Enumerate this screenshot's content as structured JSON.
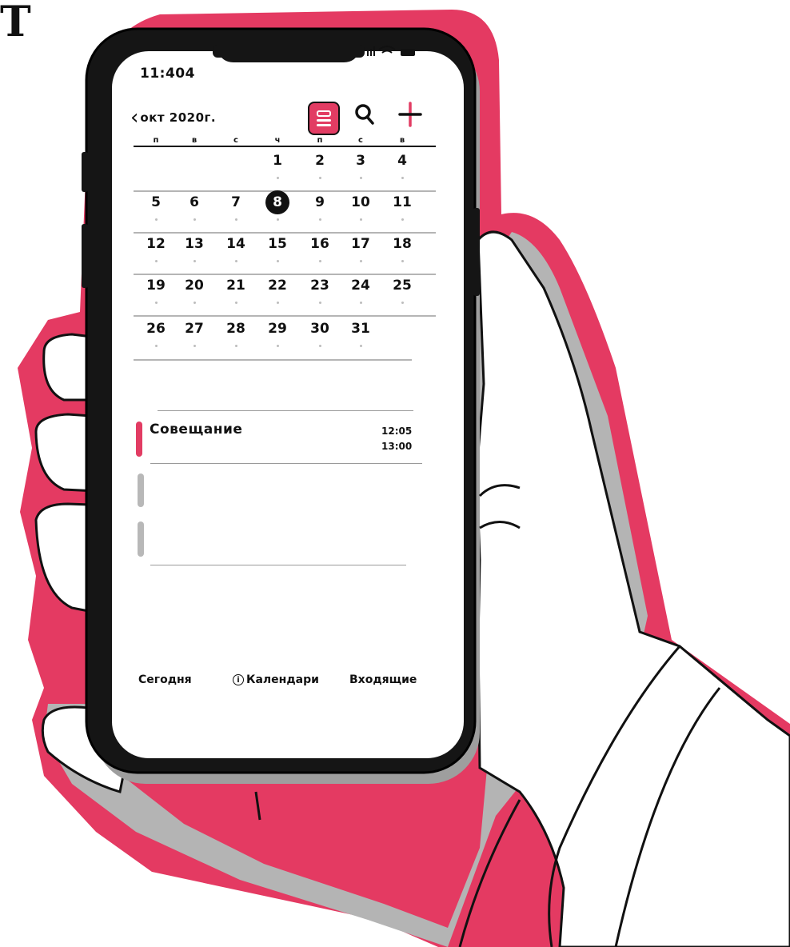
{
  "corner_mark": "Т",
  "status_bar": {
    "time": "11:404"
  },
  "header": {
    "month_label": "окт 2020г."
  },
  "calendar": {
    "weekdays": [
      "п",
      "в",
      "с",
      "ч",
      "п",
      "с",
      "в"
    ],
    "today": "8",
    "weeks": [
      [
        "",
        "",
        "",
        "1",
        "2",
        "3",
        "4"
      ],
      [
        "5",
        "6",
        "7",
        "8",
        "9",
        "10",
        "11"
      ],
      [
        "12",
        "13",
        "14",
        "15",
        "16",
        "17",
        "18"
      ],
      [
        "19",
        "20",
        "21",
        "22",
        "23",
        "24",
        "25"
      ],
      [
        "26",
        "27",
        "28",
        "29",
        "30",
        "31",
        ""
      ]
    ]
  },
  "event": {
    "title": "Совещание",
    "start": "12:05",
    "end": "13:00"
  },
  "bottom_bar": {
    "today": "Сегодня",
    "calendars_icon": "i",
    "calendars": "Календари",
    "inbox": "Входящие"
  },
  "colors": {
    "accent": "#e23c63",
    "hand_shadow": "#b4b4b4",
    "ink": "#111111"
  },
  "icons": [
    "back-chevron-icon",
    "calendar-view-icon",
    "search-icon",
    "add-icon",
    "info-icon",
    "signal-icon",
    "wifi-icon",
    "battery-icon"
  ]
}
